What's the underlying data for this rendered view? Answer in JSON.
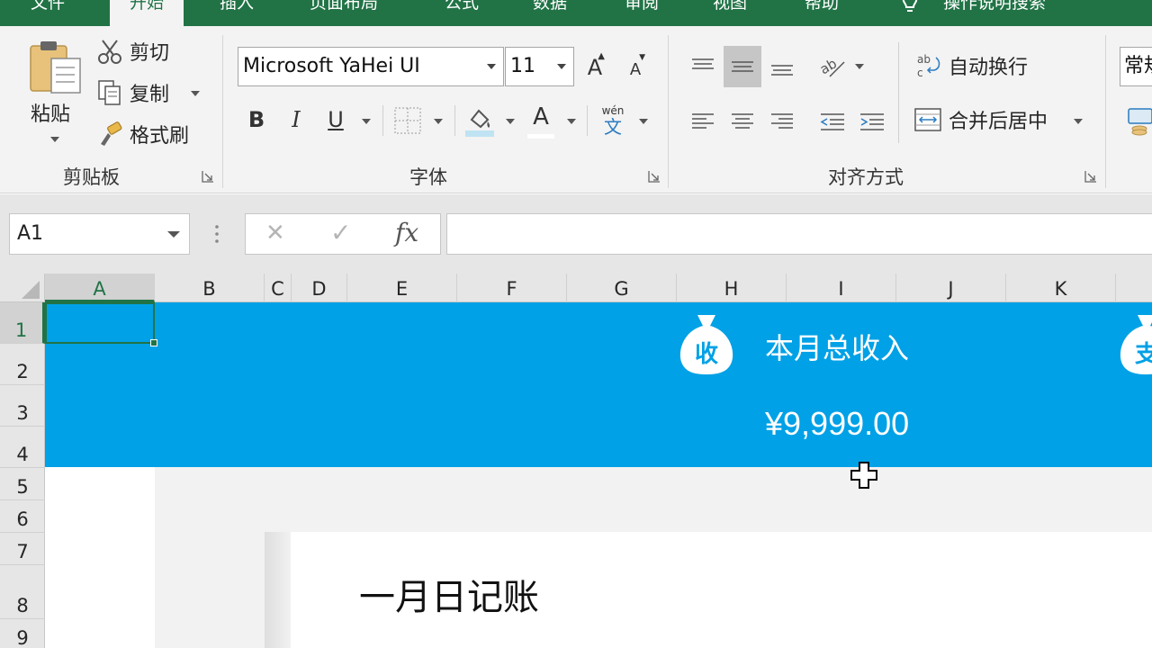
{
  "ribbon_tabs": [
    {
      "label": "文件"
    },
    {
      "label": "开始"
    },
    {
      "label": "插入"
    },
    {
      "label": "页面布局"
    },
    {
      "label": "公式"
    },
    {
      "label": "数据"
    },
    {
      "label": "审阅"
    },
    {
      "label": "视图"
    },
    {
      "label": "帮助"
    },
    {
      "label": "操作说明搜索"
    }
  ],
  "active_tab": "开始",
  "clipboard": {
    "group_label": "剪贴板",
    "paste": "粘贴",
    "cut": "剪切",
    "copy": "复制",
    "format_painter": "格式刷"
  },
  "font": {
    "group_label": "字体",
    "font_name": "Microsoft YaHei UI",
    "font_size": "11",
    "bold": "B",
    "italic": "I",
    "underline": "U",
    "font_color_glyph": "A",
    "grow_glyph": "A",
    "shrink_glyph": "A",
    "phonetic_top": "wén",
    "phonetic_bottom": "文"
  },
  "alignment": {
    "group_label": "对齐方式",
    "wrap_text": "自动换行",
    "merge_center": "合并后居中"
  },
  "number": {
    "format": "常规"
  },
  "formula_bar": {
    "name_box": "A1",
    "cancel": "✕",
    "enter": "✓",
    "fx": "fx",
    "content": ""
  },
  "columns": [
    "A",
    "B",
    "C",
    "D",
    "E",
    "F",
    "G",
    "H",
    "I",
    "J",
    "K"
  ],
  "rows": [
    "1",
    "2",
    "3",
    "4",
    "5",
    "6",
    "7",
    "8",
    "9"
  ],
  "selected_cell": "A1",
  "sheet": {
    "income_badge": "收",
    "income_label": "本月总收入",
    "income_value": "¥9,999.00",
    "expense_badge": "支",
    "card_title": "一月日记账"
  },
  "colors": {
    "excel_green": "#217346",
    "banner_blue": "#00a1e6",
    "ribbon_bg": "#f3f3f3"
  }
}
